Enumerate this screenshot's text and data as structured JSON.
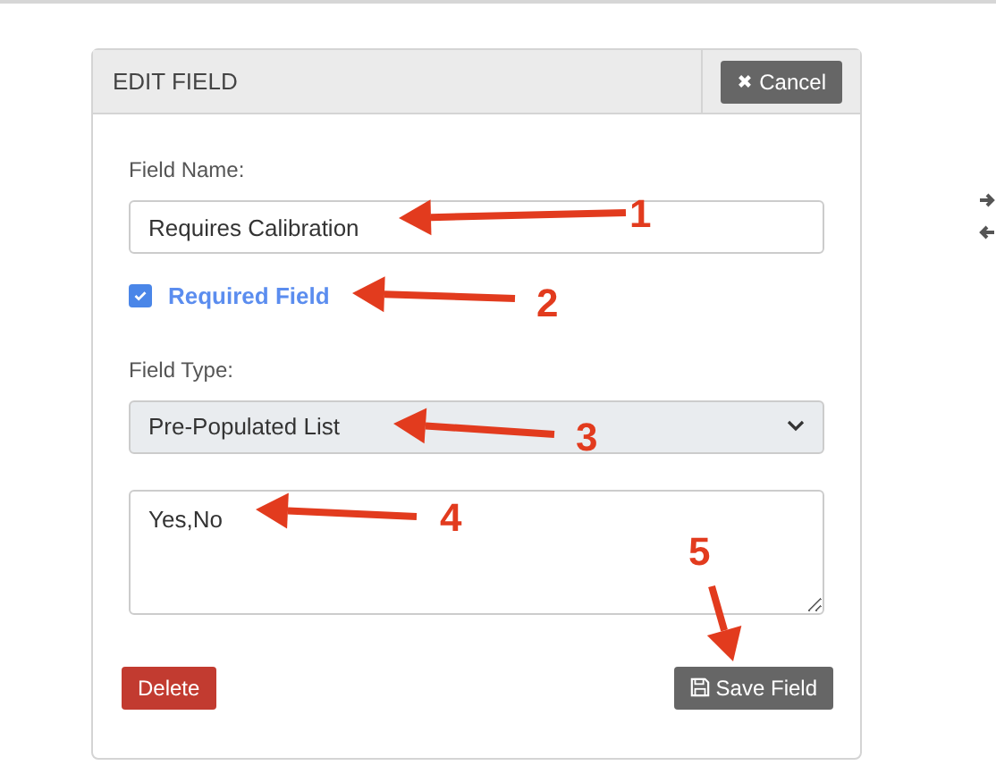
{
  "panel": {
    "title": "EDIT FIELD",
    "cancel_button": "Cancel"
  },
  "fields": [
    {
      "kind": "text",
      "label": "Field Name:",
      "value": "Requires Calibration"
    },
    {
      "kind": "checkbox",
      "label": "Required Field",
      "checked": true
    },
    {
      "kind": "select",
      "label": "Field Type:",
      "value": "Pre-Populated List"
    },
    {
      "kind": "textarea",
      "value": "Yes,No"
    }
  ],
  "buttons": {
    "delete": "Delete",
    "save": "Save Field"
  },
  "annotations": [
    {
      "label": "1"
    },
    {
      "label": "2"
    },
    {
      "label": "3"
    },
    {
      "label": "4"
    },
    {
      "label": "5"
    }
  ]
}
